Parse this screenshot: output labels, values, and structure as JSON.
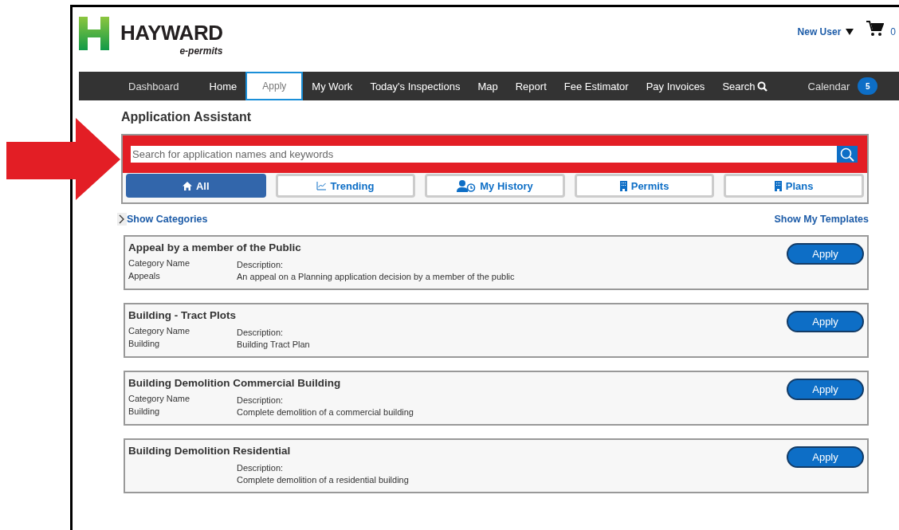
{
  "logo": {
    "name": "HAYWARD",
    "tagline": "e-permits"
  },
  "user_menu": {
    "label": "New User",
    "cart_count": "0"
  },
  "nav": [
    {
      "label": "Dashboard",
      "selected": false
    },
    {
      "label": "Home",
      "selected": false
    },
    {
      "label": "Apply",
      "selected": true
    },
    {
      "label": "My Work",
      "selected": false
    },
    {
      "label": "Today's Inspections",
      "selected": false
    },
    {
      "label": "Map",
      "selected": false
    },
    {
      "label": "Report",
      "selected": false
    },
    {
      "label": "Fee Estimator",
      "selected": false
    },
    {
      "label": "Pay Invoices",
      "selected": false
    },
    {
      "label": "Search",
      "selected": false
    }
  ],
  "calendar": {
    "label": "Calendar",
    "badge": "5"
  },
  "page_title": "Application Assistant",
  "search": {
    "placeholder": "Search for application names and keywords",
    "highlighted": true
  },
  "filters": [
    {
      "label": "All",
      "kind": "home",
      "selected": true
    },
    {
      "label": "Trending",
      "kind": "chart",
      "selected": false
    },
    {
      "label": "My History",
      "kind": "history",
      "selected": false
    },
    {
      "label": "Permits",
      "kind": "building",
      "selected": false
    },
    {
      "label": "Plans",
      "kind": "building",
      "selected": false
    }
  ],
  "show_categories": "Show Categories",
  "show_templates": "Show My Templates",
  "applications": [
    {
      "title": "Appeal by a member of the Public",
      "category_label": "Category Name",
      "category": "Appeals",
      "description_label": "Description:",
      "description": "An appeal on a Planning application decision by a member of the public",
      "button": "Apply"
    },
    {
      "title": "Building - Tract Plots",
      "category_label": "Category Name",
      "category": "Building",
      "description_label": "Description:",
      "description": "Building Tract Plan",
      "button": "Apply"
    },
    {
      "title": "Building Demolition Commercial Building",
      "category_label": "Category Name",
      "category": "Building",
      "description_label": "Description:",
      "description": "Complete demolition of a commercial building",
      "button": "Apply"
    },
    {
      "title": "Building Demolition Residential",
      "description_label": "Description:",
      "description": "Complete demolition of a residential building",
      "button": "Apply"
    }
  ]
}
